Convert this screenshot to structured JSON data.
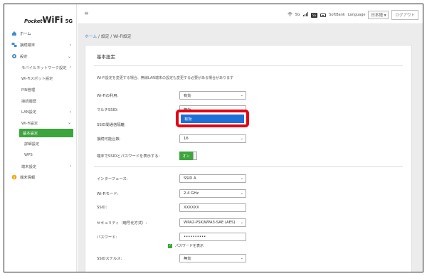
{
  "logo": {
    "part1": "Pocket",
    "part2": "WiFi",
    "part3": "5G"
  },
  "sidebar": {
    "items": [
      {
        "label": "ホーム"
      },
      {
        "label": "接続端末"
      },
      {
        "label": "設定"
      },
      {
        "label": "モバイルネットワーク設定"
      },
      {
        "label": "Wi-Fiスポット設定"
      },
      {
        "label": "PIN管理"
      },
      {
        "label": "接続履歴"
      },
      {
        "label": "LAN設定"
      },
      {
        "label": "Wi-Fi設定"
      },
      {
        "label": "基本設定"
      },
      {
        "label": "詳細設定"
      },
      {
        "label": "WPS"
      },
      {
        "label": "端末設定"
      },
      {
        "label": "端末情報"
      }
    ]
  },
  "topbar": {
    "signal_text": "5G",
    "badge": "5G",
    "carrier": "SoftBank",
    "language_label": "Language",
    "language_value": "日本語",
    "logout_label": "ログアウト"
  },
  "breadcrumb": {
    "home": "ホーム",
    "rest": " / 設定 / Wi-Fi設定"
  },
  "panel": {
    "title": "基本設定",
    "note": "Wi-Fi設定を変更する場合、無線LAN端末の設定も変更する必要がある場合があります",
    "fields": {
      "wifi_use": {
        "label": "Wi-Fiの利用:",
        "value": "有効"
      },
      "multi_ssid": {
        "label": "マルチSSID:",
        "value": "無効"
      },
      "ssid_isolation": {
        "label": "SSID間通信隔離:",
        "value": ""
      },
      "max_clients": {
        "label": "接続可能台数:",
        "value": "16"
      },
      "show_ssid_pw": {
        "label": "端末でSSIDとパスワードを表示する:",
        "value": "オン"
      },
      "interface": {
        "label": "インターフェース:",
        "value": "SSID A"
      },
      "wifi_mode": {
        "label": "Wi-Fiモード:",
        "value": "2.4 GHz"
      },
      "ssid": {
        "label": "SSID:",
        "value": "XXXXXX"
      },
      "security": {
        "label": "セキュリティ（暗号化方式）:",
        "value": "WPA2-PSK/WPA3-SAE (AES)"
      },
      "password": {
        "label": "パスワード:",
        "value": "••••••••••"
      },
      "show_password": {
        "label": "パスワードを表示"
      },
      "ssid_stealth": {
        "label": "SSIDステルス:",
        "value": "無効"
      }
    }
  },
  "dropdown": {
    "option": "有効"
  },
  "colors": {
    "accent": "#3ca53c",
    "highlight": "#e60012",
    "selected": "#1e6fd9",
    "link": "#3a8ed1"
  }
}
